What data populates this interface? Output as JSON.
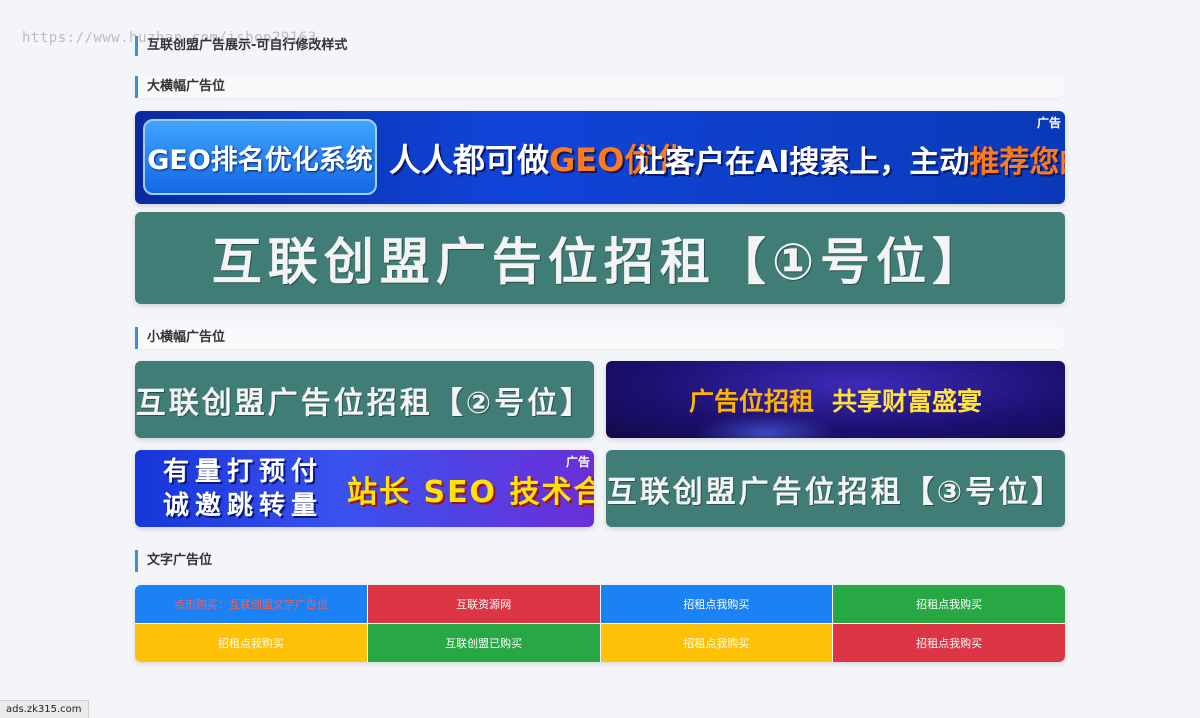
{
  "watermark": "https://www.huzhan.com/ishop29163",
  "page_title": "互联创盟广告展示-可自行修改样式",
  "sections": {
    "big": "大横幅广告位",
    "small": "小横幅广告位",
    "text": "文字广告位"
  },
  "banners": {
    "geo": {
      "pill": "GEO排名优化系统",
      "t2_pre": "人人都可做",
      "t2_orange": "GEO优化",
      "t3_pre": "让客户在AI搜索上，主动",
      "t3_orange": "推荐您的产品",
      "tag": "广告"
    },
    "rent1": "互联创盟广告位招租【①号位】",
    "rent2": "互联创盟广告位招租【②号位】",
    "purple": {
      "p1": "广告位招租",
      "p2": "共享财富盛宴"
    },
    "seo": {
      "line1": "有量打预付",
      "line2": "诚邀跳转量",
      "right": "站长 SEO 技术合作",
      "tag": "广告"
    },
    "rent3": "互联创盟广告位招租【③号位】"
  },
  "text_ads": [
    {
      "label": "点击购买：互联创盟文字广告位",
      "bg": "#1a82f5",
      "fg": "#ff5a4a"
    },
    {
      "label": "互联资源网",
      "bg": "#dc3545",
      "fg": "#ffffff"
    },
    {
      "label": "招租点我购买",
      "bg": "#1a82f5",
      "fg": "#ffffff"
    },
    {
      "label": "招租点我购买",
      "bg": "#28a745",
      "fg": "#ffffff"
    },
    {
      "label": "招租点我购买",
      "bg": "#ffc107",
      "fg": "#ffffff"
    },
    {
      "label": "互联创盟已购买",
      "bg": "#28a745",
      "fg": "#ffffff"
    },
    {
      "label": "招租点我购买",
      "bg": "#ffc107",
      "fg": "#ffffff"
    },
    {
      "label": "招租点我购买",
      "bg": "#dc3545",
      "fg": "#ffffff"
    }
  ],
  "status_bar": "ads.zk315.com"
}
